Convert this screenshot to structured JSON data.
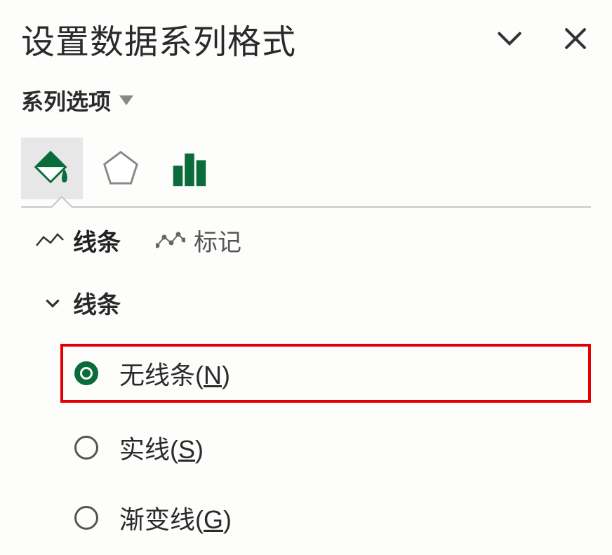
{
  "header": {
    "title": "设置数据系列格式"
  },
  "series_dropdown": {
    "label": "系列选项"
  },
  "sub_tabs": {
    "line": "线条",
    "marker": "标记"
  },
  "section": {
    "line_label": "线条"
  },
  "radio_options": {
    "no_line": {
      "text": "无线条(",
      "key": "N",
      "suffix": ")"
    },
    "solid_line": {
      "text": "实线(",
      "key": "S",
      "suffix": ")"
    },
    "gradient_line": {
      "text": "渐变线(",
      "key": "G",
      "suffix": ")"
    }
  }
}
